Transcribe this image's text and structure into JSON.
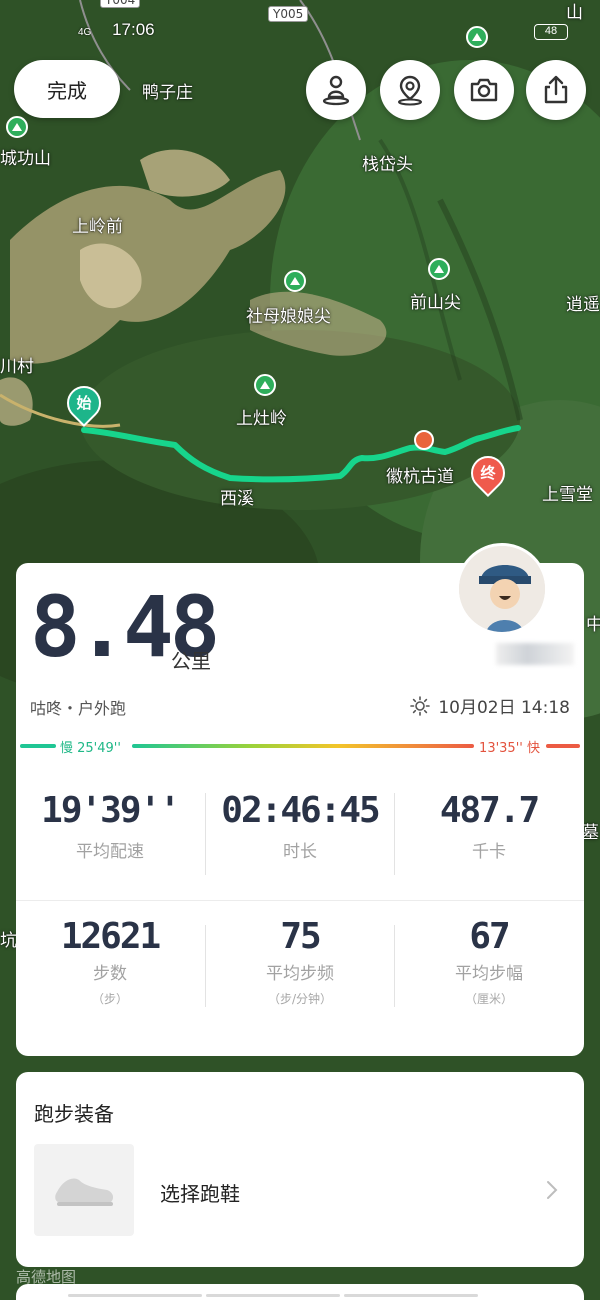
{
  "status_bar": {
    "network": "4G",
    "time": "17:06",
    "battery": "48"
  },
  "toolbar": {
    "done_label": "完成",
    "icons": [
      "person-pin-icon",
      "location-pin-icon",
      "camera-icon",
      "share-icon"
    ]
  },
  "map": {
    "labels": [
      "鸭子庄",
      "栈岱头",
      "上岭前",
      "社母娘娘尖",
      "前山尖",
      "逍遥",
      "川村",
      "上灶岭",
      "西溪",
      "徽杭古道",
      "上雪堂",
      "城功山",
      "山",
      "中",
      "墓",
      "坑"
    ],
    "road_tags": [
      "Y005",
      "Y004"
    ],
    "start_label": "始",
    "end_label": "终",
    "route_color": "#17d58c"
  },
  "summary": {
    "distance": "8.48",
    "distance_unit": "公里",
    "user_line": "咕咚・户外跑",
    "datetime": "10月02日 14:18",
    "pace_slow": "慢 25'49''",
    "pace_fast": "13'35'' 快"
  },
  "metrics_row1": [
    {
      "value": "19'39''",
      "label": "平均配速"
    },
    {
      "value": "02:46:45",
      "label": "时长"
    },
    {
      "value": "487.7",
      "label": "千卡"
    }
  ],
  "metrics_row2": [
    {
      "value": "12621",
      "label": "步数",
      "unit": "（步）"
    },
    {
      "value": "75",
      "label": "平均步频",
      "unit": "（步/分钟）"
    },
    {
      "value": "67",
      "label": "平均步幅",
      "unit": "（厘米）"
    }
  ],
  "gear": {
    "title": "跑步装备",
    "select_shoe": "选择跑鞋"
  },
  "map_brand": "高德地图",
  "colors": {
    "accent_green": "#1fc694",
    "accent_red": "#ec5b43",
    "text_dark": "#2a3347"
  }
}
